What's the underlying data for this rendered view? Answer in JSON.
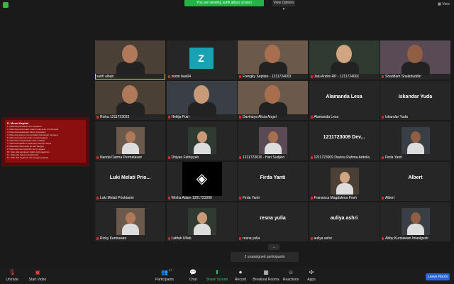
{
  "top": {
    "banner": "You are viewing suhfi alba's screen",
    "view_options": "View Options ▾",
    "view_button": "View",
    "shield_icon": "shield-icon"
  },
  "shared_screen": {
    "title": "E. Moral Kapital",
    "lines": [
      "1. Nilai-nilai persatuan dan kesatuan",
      "2. Nilai-nilai persamaan antara suku-suku di Indonesia",
      "3. Nilai-nilai kesetaraan dalam pergaulan",
      "4. Nilai-nilai gotong royong dalam kehidupan bersama",
      "5. Nilai-nilai toleransi antar umat beragama",
      "6. Nilai-nilai musyawarah untuk mufakat",
      "7. Nilai-nilai keadilan sosial bagi seluruh rakyat",
      "8. Nilai-nilai cinta tanah air dan bangsa",
      "9. Nilai-nilai rela berkorban demi negara",
      "10. Nilai-nilai persatuan dalam keberagaman",
      "11. Nilai-nilai saling menghormati",
      "12. Nilai-nilai kejujuran dan tanggung jawab"
    ]
  },
  "participants": [
    {
      "name": "suhfi albab",
      "type": "video",
      "muted": false
    },
    {
      "name": "zoom baa04",
      "type": "avatar",
      "letter": "Z",
      "muted": true
    },
    {
      "name": "Frengky Septian - 1211724003",
      "type": "video",
      "muted": true
    },
    {
      "name": "Jalu Andre RP - 1211724001",
      "type": "video",
      "muted": true
    },
    {
      "name": "Shaddam Shalahuddin",
      "type": "video",
      "muted": true
    },
    {
      "name": "Rizka 1211723023",
      "type": "video",
      "muted": true
    },
    {
      "name": "Hekija Putri",
      "type": "video",
      "muted": true
    },
    {
      "name": "Davinaya Alicia Angel",
      "type": "video",
      "muted": true
    },
    {
      "name": "Alamanda Lesa",
      "type": "name",
      "big": "Alamanda Lesa",
      "muted": true
    },
    {
      "name": "Iskandar Yuda",
      "type": "name",
      "big": "Iskandar Yuda",
      "muted": true
    },
    {
      "name": "Nanda Darma Permatasari",
      "type": "photo",
      "muted": true
    },
    {
      "name": "Dhiyaa Fathiyyah",
      "type": "photo",
      "muted": true
    },
    {
      "name": "1211723016 - Hari Sudjion",
      "type": "photo",
      "muted": true
    },
    {
      "name": "1211723009 Davina Rahma Ardelia",
      "type": "name",
      "big": "1211723009 Dev...",
      "muted": true
    },
    {
      "name": "Firda Yanti",
      "type": "photo",
      "muted": true
    },
    {
      "name": "Luki Melati Prioktarini",
      "type": "name",
      "big": "Luki Melati Prio...",
      "muted": true
    },
    {
      "name": "Wisha Adam 1201721009",
      "type": "logo",
      "muted": true
    },
    {
      "name": "Firda Yanti",
      "type": "name",
      "big": "Firda Yanti",
      "muted": true
    },
    {
      "name": "Fransisca Magdalena Foeh",
      "type": "photo",
      "muted": true
    },
    {
      "name": "Albert",
      "type": "name",
      "big": "Albert",
      "muted": true
    },
    {
      "name": "Ricky Kurniawan",
      "type": "photo",
      "muted": true
    },
    {
      "name": "Latifah Ulfah",
      "type": "photo",
      "muted": true
    },
    {
      "name": "resna yulia",
      "type": "name",
      "big": "resna yulia",
      "muted": true
    },
    {
      "name": "auliya ashri",
      "type": "name",
      "big": "auliya ashri",
      "muted": true
    },
    {
      "name": "Abby Kurniawan Imanigusti",
      "type": "photo",
      "muted": true
    }
  ],
  "unassigned": "2 unassigned participants",
  "toolbar": {
    "unmute": "Unmute",
    "start_video": "Start Video",
    "participants": "Participants",
    "participants_count": "37",
    "chat": "Chat",
    "share_screen": "Share Screen",
    "record": "Record",
    "breakout_rooms": "Breakout Rooms",
    "reactions": "Reactions",
    "apps": "Apps",
    "leave_room": "Leave Room"
  }
}
